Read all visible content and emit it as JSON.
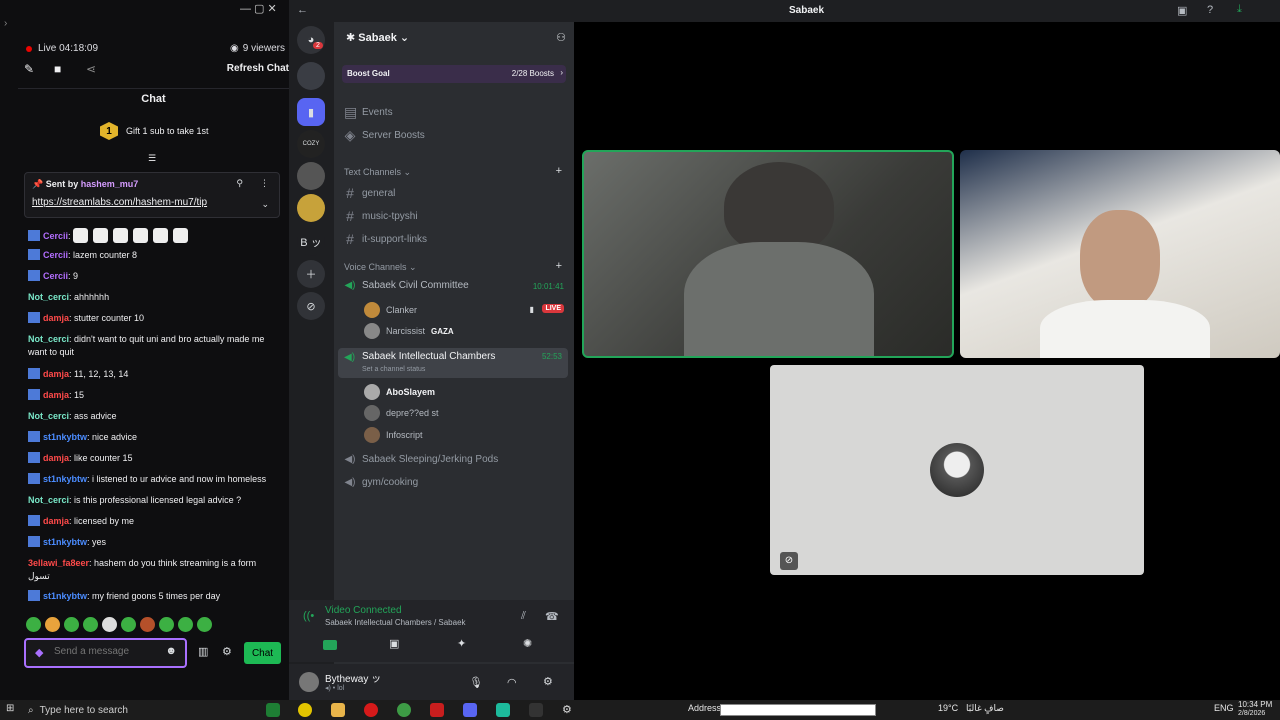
{
  "stream": {
    "live_label": "Live 04:18:09",
    "viewers": "9 viewers",
    "refresh_label": "Refresh Chat",
    "chat_title": "Chat",
    "gift_rank": "1",
    "gift_text": "Gift 1 sub to take 1st",
    "pinned_sent_by": "Sent by",
    "pinned_user": "hashem_mu7",
    "pinned_link": "https://streamlabs.com/hashem-mu7/tip",
    "input_placeholder": "Send a message",
    "chat_button": "Chat"
  },
  "messages": [
    {
      "user": "Cercii",
      "text": "",
      "emotes": 6,
      "cls": "n-cercii",
      "badge": true
    },
    {
      "user": "Cercii",
      "text": ": lazem counter 8",
      "cls": "n-cercii",
      "badge": true
    },
    {
      "user": "Cercii",
      "text": ": 9",
      "cls": "n-cercii",
      "badge": true
    },
    {
      "user": "Not_cerci",
      "text": ": ahhhhhh",
      "cls": "n-not",
      "badge": false
    },
    {
      "user": "damja",
      "text": ": stutter counter 10",
      "cls": "n-damja",
      "badge": true
    },
    {
      "user": "Not_cerci",
      "text": ": didn't want to quit uni and bro actually made me want to quit",
      "cls": "n-not",
      "badge": false,
      "wrap": true
    },
    {
      "user": "damja",
      "text": ": 11, 12, 13, 14",
      "cls": "n-damja",
      "badge": true
    },
    {
      "user": "damja",
      "text": ": 15",
      "cls": "n-damja",
      "badge": true
    },
    {
      "user": "Not_cerci",
      "text": ": ass advice",
      "cls": "n-not",
      "badge": false
    },
    {
      "user": "st1nkybtw",
      "text": ": nice advice",
      "cls": "n-stink",
      "badge": true
    },
    {
      "user": "damja",
      "text": ": like counter 15",
      "cls": "n-damja",
      "badge": true
    },
    {
      "user": "st1nkybtw",
      "text": ": i listened to ur advice and now im homeless",
      "cls": "n-stink",
      "badge": true
    },
    {
      "user": "Not_cerci",
      "text": ": is this professional licensed legal advice ?",
      "cls": "n-not",
      "badge": false
    },
    {
      "user": "damja",
      "text": ": licensed by me",
      "cls": "n-damja",
      "badge": true
    },
    {
      "user": "st1nkybtw",
      "text": ": yes",
      "cls": "n-stink",
      "badge": true
    },
    {
      "user": "3ellawi_fa8eer",
      "text": ": hashem do you think streaming is a form تسول",
      "cls": "n-3ell",
      "badge": false,
      "wrap": true
    },
    {
      "user": "st1nkybtw",
      "text": ": my friend goons 5 times per day",
      "cls": "n-stink",
      "badge": true
    }
  ],
  "discord": {
    "window_title": "Sabaek",
    "server_name": "Sabaek",
    "boost_goal": "Boost Goal",
    "boost_count": "2/28 Boosts",
    "events": "Events",
    "server_boosts": "Server Boosts",
    "text_channels_label": "Text Channels",
    "text_channels": [
      "general",
      "music-tpyshi",
      "it-support-links"
    ],
    "voice_channels_label": "Voice Channels",
    "vc1": {
      "name": "Sabaek Civil Committee",
      "time": "10:01:41",
      "users": [
        "Clanker",
        "Narcissist"
      ],
      "live": "LIVE",
      "tag": "GAZA"
    },
    "vc2": {
      "name": "Sabaek Intellectual Chambers",
      "time": "52:53",
      "status": "Set a channel status",
      "users": [
        "AboSlayem",
        "depre??ed st",
        "Infoscript"
      ]
    },
    "vc3": "Sabaek Sleeping/Jerking Pods",
    "vc4": "gym/cooking",
    "connection_status": "Video Connected",
    "connection_detail": "Sabaek Intellectual Chambers / Sabaek",
    "user_name": "Bytheway ッ",
    "user_status": "lol",
    "rail_badge": "2",
    "rail_server_label": "B ッ"
  },
  "taskbar": {
    "search": "Type here to search",
    "address_label": "Address",
    "weather": "19°C",
    "weather_ar": "صافٍ غالبًا",
    "lang": "ENG",
    "time": "10:34 PM",
    "date": "2/8/2026"
  },
  "colors": {
    "accent_purple": "#a970ff",
    "discord_green": "#23a559",
    "live_red": "#da373c"
  }
}
